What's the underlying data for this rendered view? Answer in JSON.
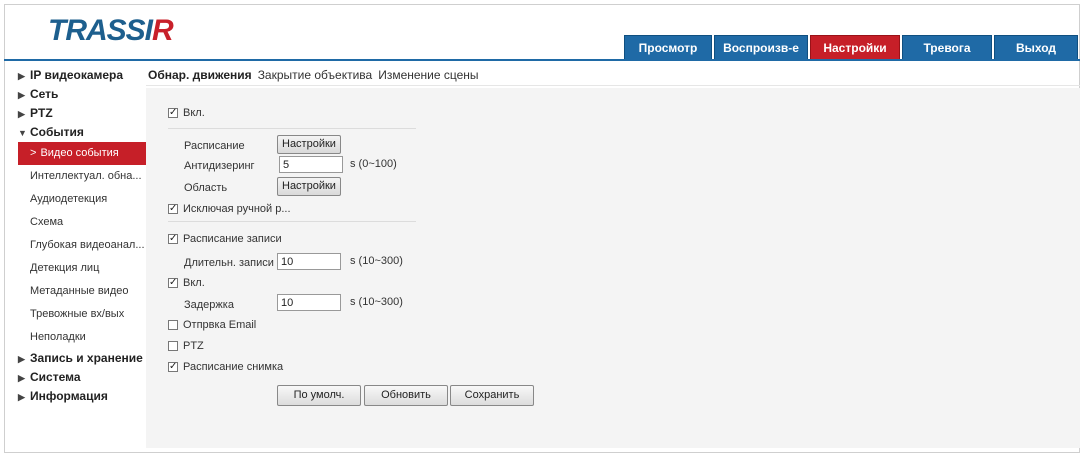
{
  "logo": {
    "text_main": "TRASSI",
    "text_accent": "R"
  },
  "topnav": [
    {
      "label": "Просмотр",
      "active": false
    },
    {
      "label": "Воспроизв-е",
      "active": false
    },
    {
      "label": "Настройки",
      "active": true
    },
    {
      "label": "Тревога",
      "active": false
    },
    {
      "label": "Выход",
      "active": false
    }
  ],
  "sidebar": {
    "groups_top": [
      {
        "label": "IP видеокамера",
        "arrow": "▶"
      },
      {
        "label": "Сеть",
        "arrow": "▶"
      },
      {
        "label": "PTZ",
        "arrow": "▶"
      },
      {
        "label": "События",
        "arrow": "▼"
      }
    ],
    "events_items": [
      {
        "label": "Видео события",
        "active": true
      },
      {
        "label": "Интеллектуал. обна...",
        "active": false
      },
      {
        "label": "Аудиодетекция",
        "active": false
      },
      {
        "label": "Схема",
        "active": false
      },
      {
        "label": "Глубокая видеоанал...",
        "active": false
      },
      {
        "label": "Детекция лиц",
        "active": false
      },
      {
        "label": "Метаданные видео",
        "active": false
      },
      {
        "label": "Тревожные вх/вых",
        "active": false
      },
      {
        "label": "Неполадки",
        "active": false
      }
    ],
    "groups_bottom": [
      {
        "label": "Запись и хранение",
        "arrow": "▶"
      },
      {
        "label": "Система",
        "arrow": "▶"
      },
      {
        "label": "Информация",
        "arrow": "▶"
      }
    ]
  },
  "subtabs": [
    {
      "label": "Обнар. движения",
      "active": true
    },
    {
      "label": "Закрытие объектива",
      "active": false
    },
    {
      "label": "Изменение сцены",
      "active": false
    }
  ],
  "form": {
    "enable": {
      "label": "Вкл.",
      "checked": true
    },
    "schedule": {
      "label": "Расписание",
      "button": "Настройки"
    },
    "antidither": {
      "label": "Антидизеринг",
      "value": "5",
      "hint": "s (0~100)"
    },
    "area": {
      "label": "Область",
      "button": "Настройки"
    },
    "exclude_manual": {
      "label": "Исключая ручной р...",
      "checked": true
    },
    "record_schedule": {
      "label": "Расписание записи",
      "checked": true
    },
    "record_duration": {
      "label": "Длительн. записи",
      "value": "10",
      "hint": "s (10~300)"
    },
    "enable2": {
      "label": "Вкл.",
      "checked": true
    },
    "delay": {
      "label": "Задержка",
      "value": "10",
      "hint": "s (10~300)"
    },
    "send_email": {
      "label": "Отпрвка Email",
      "checked": false
    },
    "ptz": {
      "label": "PTZ",
      "checked": false
    },
    "snapshot_schedule": {
      "label": "Расписание снимка",
      "checked": true
    }
  },
  "actions": {
    "default": "По умолч.",
    "refresh": "Обновить",
    "save": "Сохранить"
  },
  "check_glyph": "✓",
  "colors": {
    "brand_blue": "#1f6aa6",
    "active_red": "#c61f28",
    "panel_bg": "#f4f4f4"
  }
}
